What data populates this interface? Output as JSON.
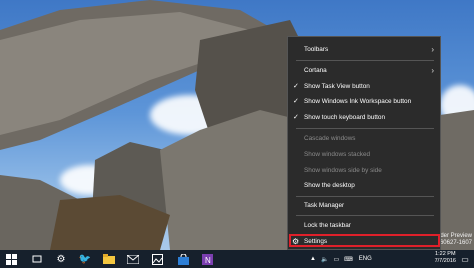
{
  "desktop": {
    "watermark": {
      "line1": "der Preview",
      "line2": "60627-1607"
    }
  },
  "context_menu": {
    "items": [
      {
        "label": "Toolbars",
        "has_submenu": true,
        "checked": false,
        "disabled": false
      },
      {
        "label": "Cortana",
        "has_submenu": true,
        "checked": false,
        "disabled": false
      },
      {
        "label": "Show Task View button",
        "has_submenu": false,
        "checked": true,
        "disabled": false
      },
      {
        "label": "Show Windows Ink Workspace button",
        "has_submenu": false,
        "checked": true,
        "disabled": false
      },
      {
        "label": "Show touch keyboard button",
        "has_submenu": false,
        "checked": true,
        "disabled": false
      },
      {
        "label": "Cascade windows",
        "has_submenu": false,
        "checked": false,
        "disabled": true
      },
      {
        "label": "Show windows stacked",
        "has_submenu": false,
        "checked": false,
        "disabled": true
      },
      {
        "label": "Show windows side by side",
        "has_submenu": false,
        "checked": false,
        "disabled": true
      },
      {
        "label": "Show the desktop",
        "has_submenu": false,
        "checked": false,
        "disabled": false
      },
      {
        "label": "Task Manager",
        "has_submenu": false,
        "checked": false,
        "disabled": false
      },
      {
        "label": "Lock the taskbar",
        "has_submenu": false,
        "checked": false,
        "disabled": false
      },
      {
        "label": "Settings",
        "has_submenu": false,
        "checked": false,
        "disabled": false,
        "icon": "gear-icon",
        "highlighted": true
      }
    ],
    "highlight_color": "#e0202a"
  },
  "taskbar": {
    "background": "#16202c",
    "icons": [
      "start-icon",
      "task-view-icon",
      "file-explorer-icon",
      "settings-icon",
      "twitter-icon",
      "store-icon",
      "mail-icon",
      "photos-icon",
      "onenote-icon"
    ],
    "tray": {
      "language": "ENG",
      "time": "1:22 PM",
      "date": "7/7/2016"
    }
  }
}
